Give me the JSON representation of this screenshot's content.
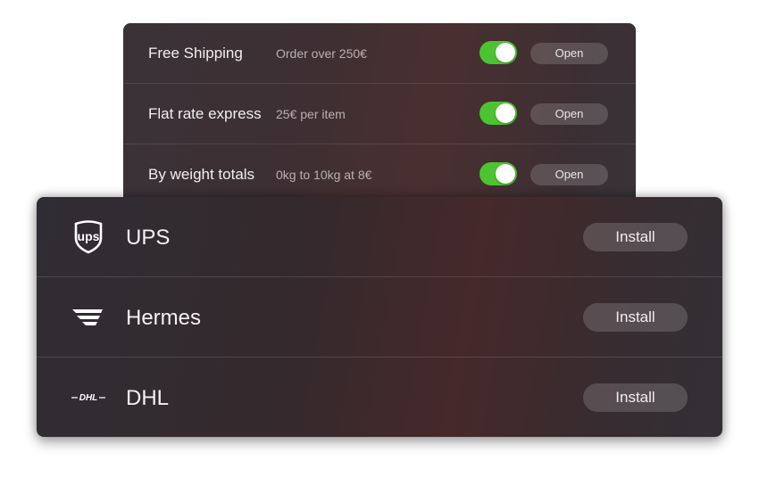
{
  "shipping_rates": [
    {
      "name": "Free Shipping",
      "description": "Order over 250€",
      "enabled": true,
      "action_label": "Open"
    },
    {
      "name": "Flat rate express",
      "description": "25€ per item",
      "enabled": true,
      "action_label": "Open"
    },
    {
      "name": "By weight totals",
      "description": "0kg to 10kg at 8€",
      "enabled": true,
      "action_label": "Open"
    }
  ],
  "carriers": [
    {
      "name": "UPS",
      "logo_text": "ups",
      "icon": "ups-logo-icon",
      "action_label": "Install"
    },
    {
      "name": "Hermes",
      "icon": "hermes-logo-icon",
      "action_label": "Install"
    },
    {
      "name": "DHL",
      "logo_text": "DHL",
      "icon": "dhl-logo-icon",
      "action_label": "Install"
    }
  ],
  "colors": {
    "toggle_on": "#4cc431",
    "panel_dark": "#35292d"
  }
}
